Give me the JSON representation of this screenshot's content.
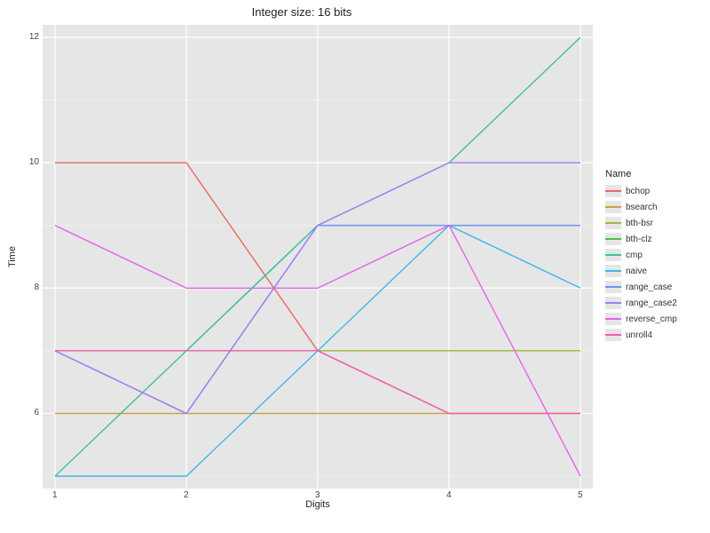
{
  "chart_data": {
    "type": "line",
    "title": "Integer size: 16 bits",
    "xlabel": "Digits",
    "ylabel": "Time",
    "xlim": [
      1,
      5
    ],
    "ylim": [
      5,
      12
    ],
    "y_ticks": [
      6,
      8,
      10,
      12
    ],
    "y_minor_ticks": [
      5,
      7,
      9,
      11
    ],
    "x_ticks": [
      1,
      2,
      3,
      4,
      5
    ],
    "legend_title": "Name",
    "series": [
      {
        "name": "bchop",
        "color": "#e7695f",
        "x": [
          1,
          2,
          3,
          4,
          5
        ],
        "y": [
          10,
          10,
          7,
          6,
          6
        ]
      },
      {
        "name": "bsearch",
        "color": "#cf9c3a",
        "x": [
          1,
          2,
          3,
          4,
          5
        ],
        "y": [
          6,
          6,
          6,
          6,
          6
        ]
      },
      {
        "name": "bth-bsr",
        "color": "#9cb63b",
        "x": [
          1,
          2,
          3,
          4,
          5
        ],
        "y": [
          7,
          7,
          7,
          7,
          7
        ]
      },
      {
        "name": "bth-clz",
        "color": "#4fbb4a",
        "x": [
          1,
          2,
          3,
          4,
          5
        ],
        "y": [
          7,
          7,
          9,
          9,
          9
        ]
      },
      {
        "name": "cmp",
        "color": "#3ec0a3",
        "x": [
          1,
          2,
          3,
          4,
          5
        ],
        "y": [
          5,
          7,
          9,
          10,
          12
        ]
      },
      {
        "name": "naive",
        "color": "#3fb8e9",
        "x": [
          1,
          2,
          3,
          4,
          5
        ],
        "y": [
          5,
          5,
          7,
          9,
          8
        ]
      },
      {
        "name": "range_case",
        "color": "#6e93f5",
        "x": [
          1,
          2,
          3,
          4,
          5
        ],
        "y": [
          7,
          6,
          9,
          9,
          9
        ]
      },
      {
        "name": "range_case2",
        "color": "#9d7ff5",
        "x": [
          1,
          2,
          3,
          4,
          5
        ],
        "y": [
          7,
          6,
          9,
          10,
          10
        ]
      },
      {
        "name": "reverse_cmp",
        "color": "#e564e9",
        "x": [
          1,
          2,
          3,
          4,
          5
        ],
        "y": [
          9,
          8,
          8,
          9,
          5
        ]
      },
      {
        "name": "unroll4",
        "color": "#f35fb2",
        "x": [
          1,
          2,
          3,
          4,
          5
        ],
        "y": [
          7,
          7,
          7,
          6,
          6
        ]
      }
    ]
  }
}
